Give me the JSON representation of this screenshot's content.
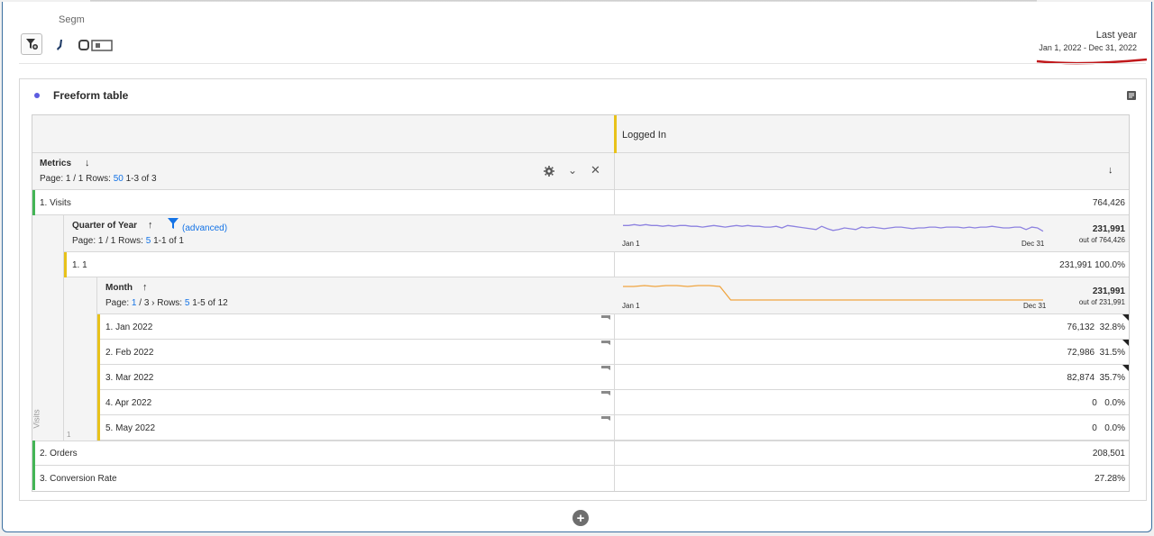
{
  "header": {
    "segment_label": "Segm",
    "date_title": "Last year",
    "date_range": "Jan 1, 2022 - Dec 31, 2022"
  },
  "panel": {
    "title": "Freeform table"
  },
  "table": {
    "column_header": "Logged In",
    "metrics_label": "Metrics",
    "metrics_page_prefix": "Page: 1 / 1  Rows:",
    "metrics_rows": "50",
    "metrics_range": "1-3 of 3",
    "visits": {
      "label": "1.  Visits",
      "value": "764,426"
    },
    "quarter": {
      "label": "Quarter of Year",
      "advanced": "(advanced)",
      "page_prefix": "Page: 1 / 1  Rows:",
      "rows": "5",
      "range": "1-1 of 1",
      "total": "231,991",
      "outof": "out of 764,426",
      "spark_start": "Jan 1",
      "spark_end": "Dec 31"
    },
    "quarter_row": {
      "label": "1.  1",
      "value": "231,991",
      "pct": "100.0%"
    },
    "month": {
      "label": "Month",
      "page_prefix": "Page:",
      "page_current": "1",
      "page_total": "/ 3",
      "rows_label": "Rows:",
      "rows": "5",
      "range": "1-5 of 12",
      "total": "231,991",
      "outof": "out of 231,991",
      "spark_start": "Jan 1",
      "spark_end": "Dec 31"
    },
    "months": [
      {
        "label": "1.  Jan 2022",
        "value": "76,132",
        "pct": "32.8%"
      },
      {
        "label": "2.  Feb 2022",
        "value": "72,986",
        "pct": "31.5%"
      },
      {
        "label": "3.  Mar 2022",
        "value": "82,874",
        "pct": "35.7%"
      },
      {
        "label": "4.  Apr 2022",
        "value": "0",
        "pct": "0.0%"
      },
      {
        "label": "5.  May 2022",
        "value": "0",
        "pct": "0.0%"
      }
    ],
    "side_visits": "Visits",
    "side_one": "1",
    "orders": {
      "label": "2.  Orders",
      "value": "208,501"
    },
    "conversion": {
      "label": "3.  Conversion Rate",
      "value": "27.28%"
    }
  },
  "colors": {
    "visits_bar": "#44b556",
    "logged_in_bar": "#e8c21a",
    "quarter_spark": "#8d82e0",
    "month_spark": "#f0a540",
    "accent": "#1473e6"
  },
  "sparklines": {
    "quarter": [
      9,
      9,
      8,
      9,
      8,
      9,
      9,
      10,
      9,
      10,
      9,
      9,
      10,
      10,
      11,
      10,
      9,
      10,
      11,
      10,
      9,
      10,
      9,
      10,
      10,
      11,
      11,
      10,
      12,
      9,
      10,
      11,
      12,
      13,
      14,
      10,
      13,
      15,
      14,
      12,
      13,
      14,
      11,
      12,
      11,
      12,
      13,
      12,
      11,
      11,
      12,
      13,
      12,
      12,
      11,
      11,
      12,
      11,
      11,
      11,
      12,
      11,
      12,
      11,
      11,
      10,
      11,
      12,
      12,
      11,
      11,
      14,
      11,
      12,
      16
    ],
    "month": [
      6,
      6,
      5,
      6,
      5,
      5,
      6,
      5,
      5,
      6,
      21,
      21,
      21,
      21,
      21,
      21,
      21,
      21,
      21,
      21,
      21,
      21,
      21,
      21,
      21,
      21,
      21,
      21,
      21,
      21,
      21,
      21,
      21,
      21,
      21,
      21,
      21,
      21,
      21,
      21
    ]
  }
}
